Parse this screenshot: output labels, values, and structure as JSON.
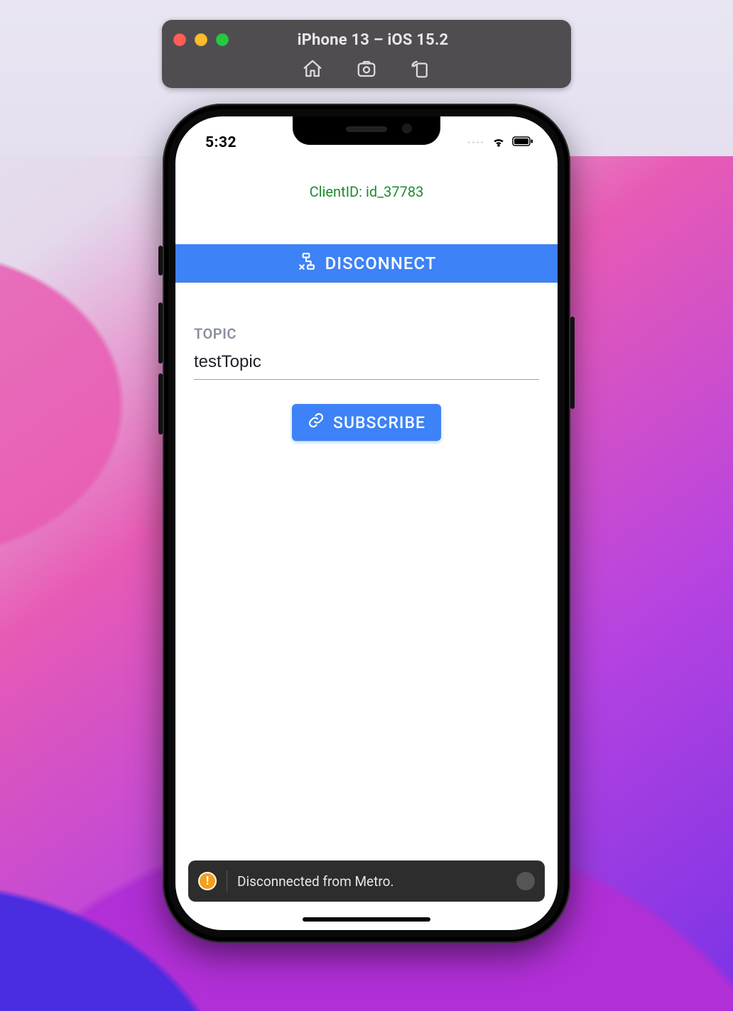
{
  "simulator": {
    "title": "iPhone 13 – iOS 15.2",
    "tools": {
      "home": "home-icon",
      "screenshot": "screenshot-icon",
      "rotate": "rotate-icon"
    }
  },
  "statusbar": {
    "time": "5:32",
    "signal_dots": "····"
  },
  "app": {
    "client_id_label": "ClientID: id_37783",
    "disconnect_label": "DISCONNECT",
    "topic_field_label": "TOPIC",
    "topic_value": "testTopic",
    "subscribe_label": "SUBSCRIBE"
  },
  "toast": {
    "message": "Disconnected from Metro.",
    "icon_glyph": "!"
  },
  "colors": {
    "primary": "#3d82f6",
    "success": "#1b8c2e",
    "toast_bg": "#2d2d2d",
    "warn": "#f0a020"
  }
}
